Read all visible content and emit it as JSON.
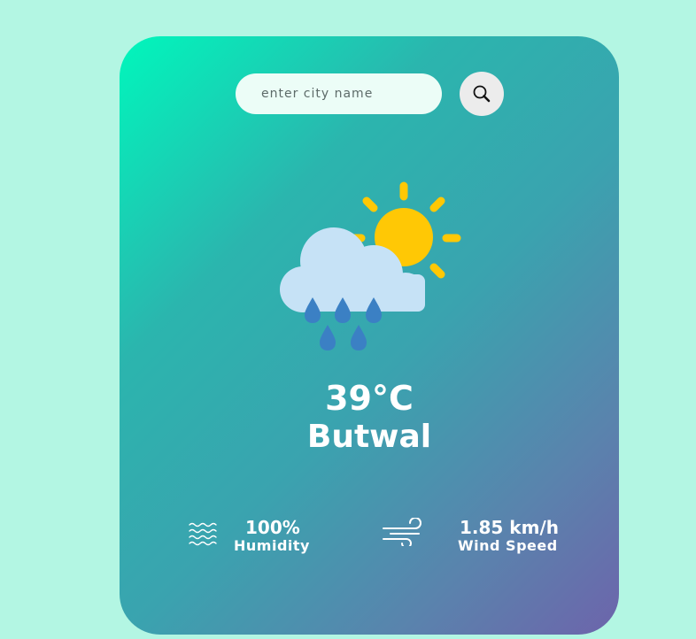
{
  "search": {
    "placeholder": "enter city name",
    "button_icon": "search-icon"
  },
  "weather": {
    "icon": "rain-sun-cloud-icon",
    "temperature": "39°C",
    "city": "Butwal"
  },
  "details": {
    "humidity": {
      "icon": "humidity-waves-icon",
      "value": "100%",
      "label": "Humidity"
    },
    "wind": {
      "icon": "wind-icon",
      "value": "1.85 km/h",
      "label": "Wind Speed"
    }
  },
  "colors": {
    "background": "#b3f6e3",
    "card_gradient_start": "#00f7bc",
    "card_gradient_end": "#6d64ab",
    "sun": "#ffc805",
    "cloud": "#c6e2f6",
    "raindrop": "#3b80c4"
  }
}
